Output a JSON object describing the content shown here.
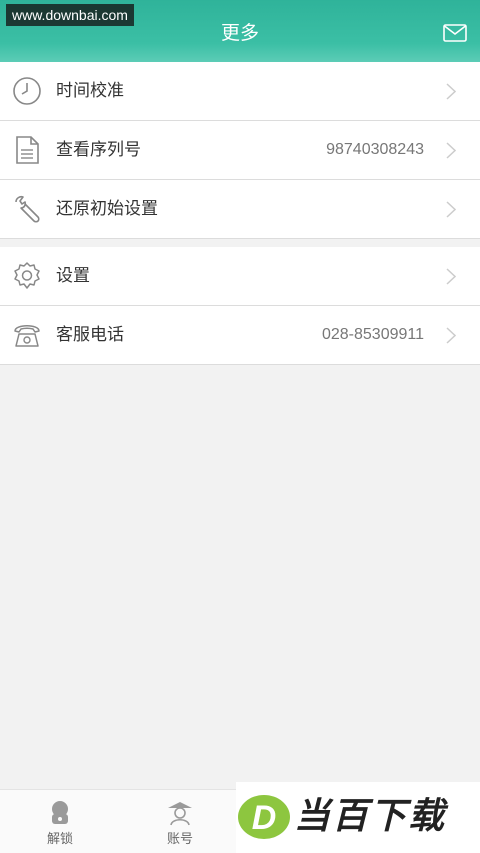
{
  "watermark": "www.downbai.com",
  "header": {
    "title": "更多",
    "mail_icon": "mail-icon"
  },
  "group1": [
    {
      "icon": "clock-icon",
      "label": "时间校准",
      "value": ""
    },
    {
      "icon": "document-icon",
      "label": "查看序列号",
      "value": "98740308243"
    },
    {
      "icon": "wrench-icon",
      "label": "还原初始设置",
      "value": ""
    }
  ],
  "group2": [
    {
      "icon": "gear-icon",
      "label": "设置",
      "value": ""
    },
    {
      "icon": "telephone-icon",
      "label": "客服电话",
      "value": "028-85309911"
    }
  ],
  "tabbar": {
    "tabs": [
      {
        "icon": "unlock-icon",
        "label": "解锁"
      },
      {
        "icon": "account-icon",
        "label": "账号"
      }
    ]
  },
  "brand": {
    "logo_letter": "D",
    "text": "当百下载"
  },
  "colors": {
    "header": "#3bbfa5",
    "brand_green": "#8dc63f"
  }
}
